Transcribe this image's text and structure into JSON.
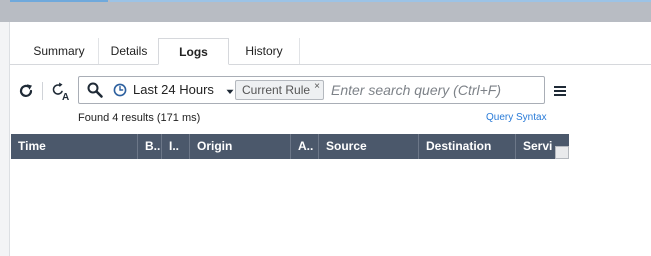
{
  "tabs": [
    {
      "label": "Summary"
    },
    {
      "label": "Details"
    },
    {
      "label": "Logs"
    },
    {
      "label": "History"
    }
  ],
  "active_tab": "Logs",
  "toolbar": {
    "time_range": "Last 24 Hours",
    "filter_chip": "Current Rule",
    "chip_close": "×",
    "search_placeholder": "Enter search query (Ctrl+F)"
  },
  "results": {
    "summary": "Found 4 results (171 ms)",
    "query_syntax_link": "Query Syntax"
  },
  "table": {
    "columns": [
      "Time",
      "B..",
      "I..",
      "Origin",
      "A..",
      "Source",
      "Destination",
      "Servi"
    ]
  },
  "colors": {
    "header_bg": "#4b586b",
    "accent_blue": "#2a7bd8",
    "top_strip": "#6fa9dc"
  }
}
